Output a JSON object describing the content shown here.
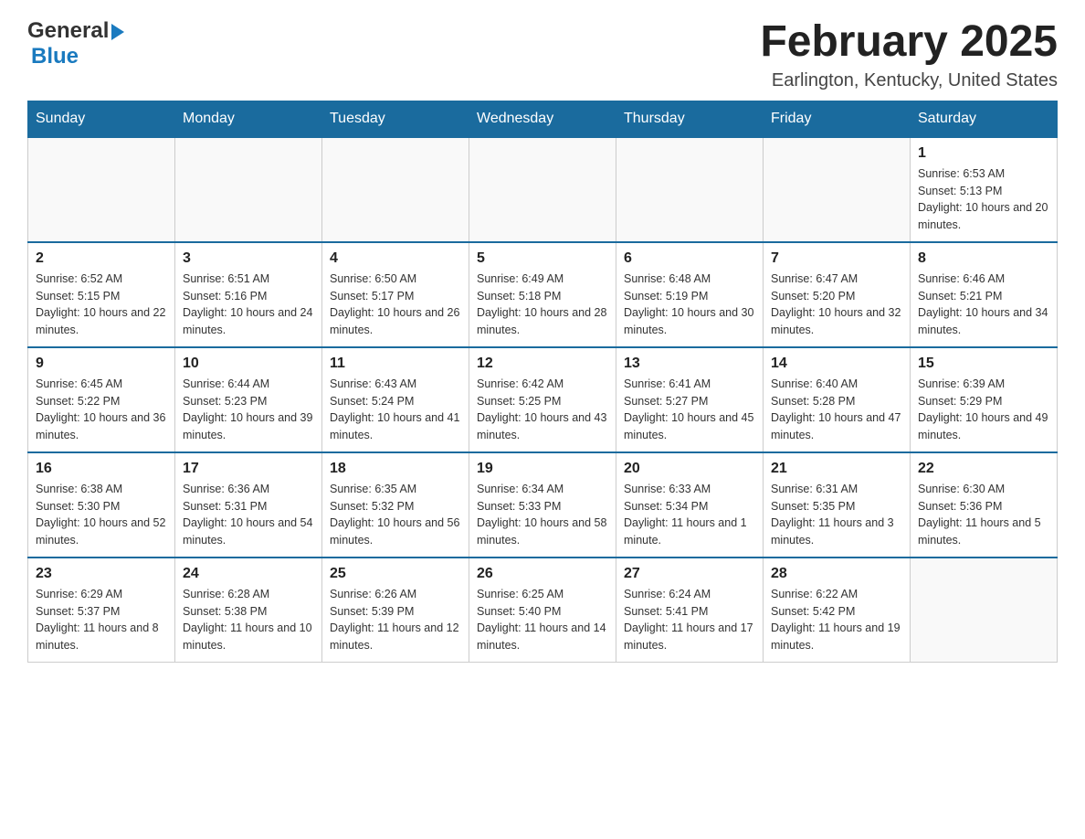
{
  "header": {
    "logo_general": "General",
    "logo_blue": "Blue",
    "month_title": "February 2025",
    "location": "Earlington, Kentucky, United States"
  },
  "weekdays": [
    "Sunday",
    "Monday",
    "Tuesday",
    "Wednesday",
    "Thursday",
    "Friday",
    "Saturday"
  ],
  "rows": [
    [
      {
        "day": "",
        "sunrise": "",
        "sunset": "",
        "daylight": ""
      },
      {
        "day": "",
        "sunrise": "",
        "sunset": "",
        "daylight": ""
      },
      {
        "day": "",
        "sunrise": "",
        "sunset": "",
        "daylight": ""
      },
      {
        "day": "",
        "sunrise": "",
        "sunset": "",
        "daylight": ""
      },
      {
        "day": "",
        "sunrise": "",
        "sunset": "",
        "daylight": ""
      },
      {
        "day": "",
        "sunrise": "",
        "sunset": "",
        "daylight": ""
      },
      {
        "day": "1",
        "sunrise": "Sunrise: 6:53 AM",
        "sunset": "Sunset: 5:13 PM",
        "daylight": "Daylight: 10 hours and 20 minutes."
      }
    ],
    [
      {
        "day": "2",
        "sunrise": "Sunrise: 6:52 AM",
        "sunset": "Sunset: 5:15 PM",
        "daylight": "Daylight: 10 hours and 22 minutes."
      },
      {
        "day": "3",
        "sunrise": "Sunrise: 6:51 AM",
        "sunset": "Sunset: 5:16 PM",
        "daylight": "Daylight: 10 hours and 24 minutes."
      },
      {
        "day": "4",
        "sunrise": "Sunrise: 6:50 AM",
        "sunset": "Sunset: 5:17 PM",
        "daylight": "Daylight: 10 hours and 26 minutes."
      },
      {
        "day": "5",
        "sunrise": "Sunrise: 6:49 AM",
        "sunset": "Sunset: 5:18 PM",
        "daylight": "Daylight: 10 hours and 28 minutes."
      },
      {
        "day": "6",
        "sunrise": "Sunrise: 6:48 AM",
        "sunset": "Sunset: 5:19 PM",
        "daylight": "Daylight: 10 hours and 30 minutes."
      },
      {
        "day": "7",
        "sunrise": "Sunrise: 6:47 AM",
        "sunset": "Sunset: 5:20 PM",
        "daylight": "Daylight: 10 hours and 32 minutes."
      },
      {
        "day": "8",
        "sunrise": "Sunrise: 6:46 AM",
        "sunset": "Sunset: 5:21 PM",
        "daylight": "Daylight: 10 hours and 34 minutes."
      }
    ],
    [
      {
        "day": "9",
        "sunrise": "Sunrise: 6:45 AM",
        "sunset": "Sunset: 5:22 PM",
        "daylight": "Daylight: 10 hours and 36 minutes."
      },
      {
        "day": "10",
        "sunrise": "Sunrise: 6:44 AM",
        "sunset": "Sunset: 5:23 PM",
        "daylight": "Daylight: 10 hours and 39 minutes."
      },
      {
        "day": "11",
        "sunrise": "Sunrise: 6:43 AM",
        "sunset": "Sunset: 5:24 PM",
        "daylight": "Daylight: 10 hours and 41 minutes."
      },
      {
        "day": "12",
        "sunrise": "Sunrise: 6:42 AM",
        "sunset": "Sunset: 5:25 PM",
        "daylight": "Daylight: 10 hours and 43 minutes."
      },
      {
        "day": "13",
        "sunrise": "Sunrise: 6:41 AM",
        "sunset": "Sunset: 5:27 PM",
        "daylight": "Daylight: 10 hours and 45 minutes."
      },
      {
        "day": "14",
        "sunrise": "Sunrise: 6:40 AM",
        "sunset": "Sunset: 5:28 PM",
        "daylight": "Daylight: 10 hours and 47 minutes."
      },
      {
        "day": "15",
        "sunrise": "Sunrise: 6:39 AM",
        "sunset": "Sunset: 5:29 PM",
        "daylight": "Daylight: 10 hours and 49 minutes."
      }
    ],
    [
      {
        "day": "16",
        "sunrise": "Sunrise: 6:38 AM",
        "sunset": "Sunset: 5:30 PM",
        "daylight": "Daylight: 10 hours and 52 minutes."
      },
      {
        "day": "17",
        "sunrise": "Sunrise: 6:36 AM",
        "sunset": "Sunset: 5:31 PM",
        "daylight": "Daylight: 10 hours and 54 minutes."
      },
      {
        "day": "18",
        "sunrise": "Sunrise: 6:35 AM",
        "sunset": "Sunset: 5:32 PM",
        "daylight": "Daylight: 10 hours and 56 minutes."
      },
      {
        "day": "19",
        "sunrise": "Sunrise: 6:34 AM",
        "sunset": "Sunset: 5:33 PM",
        "daylight": "Daylight: 10 hours and 58 minutes."
      },
      {
        "day": "20",
        "sunrise": "Sunrise: 6:33 AM",
        "sunset": "Sunset: 5:34 PM",
        "daylight": "Daylight: 11 hours and 1 minute."
      },
      {
        "day": "21",
        "sunrise": "Sunrise: 6:31 AM",
        "sunset": "Sunset: 5:35 PM",
        "daylight": "Daylight: 11 hours and 3 minutes."
      },
      {
        "day": "22",
        "sunrise": "Sunrise: 6:30 AM",
        "sunset": "Sunset: 5:36 PM",
        "daylight": "Daylight: 11 hours and 5 minutes."
      }
    ],
    [
      {
        "day": "23",
        "sunrise": "Sunrise: 6:29 AM",
        "sunset": "Sunset: 5:37 PM",
        "daylight": "Daylight: 11 hours and 8 minutes."
      },
      {
        "day": "24",
        "sunrise": "Sunrise: 6:28 AM",
        "sunset": "Sunset: 5:38 PM",
        "daylight": "Daylight: 11 hours and 10 minutes."
      },
      {
        "day": "25",
        "sunrise": "Sunrise: 6:26 AM",
        "sunset": "Sunset: 5:39 PM",
        "daylight": "Daylight: 11 hours and 12 minutes."
      },
      {
        "day": "26",
        "sunrise": "Sunrise: 6:25 AM",
        "sunset": "Sunset: 5:40 PM",
        "daylight": "Daylight: 11 hours and 14 minutes."
      },
      {
        "day": "27",
        "sunrise": "Sunrise: 6:24 AM",
        "sunset": "Sunset: 5:41 PM",
        "daylight": "Daylight: 11 hours and 17 minutes."
      },
      {
        "day": "28",
        "sunrise": "Sunrise: 6:22 AM",
        "sunset": "Sunset: 5:42 PM",
        "daylight": "Daylight: 11 hours and 19 minutes."
      },
      {
        "day": "",
        "sunrise": "",
        "sunset": "",
        "daylight": ""
      }
    ]
  ]
}
